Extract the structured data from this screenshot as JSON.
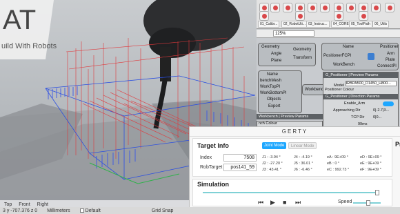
{
  "viewport": {
    "logo_letters": "AT",
    "logo_tagline": "uild With Robots",
    "view_tabs": [
      "Top",
      "Front",
      "Right"
    ],
    "units": "Millimeters",
    "default_label": "Default",
    "grid_snap": "Grid Snap",
    "coords": "3  y -707.376  z 0"
  },
  "grasshopper": {
    "ribbon_tabs": [
      "01_Calibr...",
      "02_RobotUti...",
      "03_Instruc...",
      "04_CORE",
      "05_ToolPath",
      "06_Utils"
    ],
    "zoom": "125%",
    "nodes": {
      "geom_in": [
        "Geometry",
        "Angle",
        "Plane"
      ],
      "geom_out": [
        "Geometry",
        "Transform"
      ],
      "positioner_in": [
        "Name",
        "PositionerFCPI",
        "WorkBench"
      ],
      "positioner_out": [
        "Positioner",
        "Arm",
        "Plate",
        "ConnectPl"
      ],
      "workbench_in": [
        "Name",
        "benchMesh",
        "WorkTopPl",
        "WorkBottomPl",
        "Objects",
        "Export"
      ],
      "workbench_label": "Workbench",
      "workbench_preview": "Workbench | Preview Params",
      "bench_colour": "nch Colour"
    },
    "pos_panel": {
      "header": "G_Positioner | Preview Params",
      "model_label": "Model",
      "model_value": "IRBPA500_D1450_H800...",
      "colour_label": "Positioner Colour",
      "dir_header": "G_Positioner | Direction Params",
      "enable_arm": "Enable_Arm",
      "approach_label": "Approaching Dir",
      "approach_value": "0|-2.7|3...",
      "tcp_label": "TCP Dir",
      "tcp_value": "0|0...",
      "footer": "99ms"
    }
  },
  "gerty": {
    "title": "GERTY",
    "target_info": {
      "heading": "Target Info",
      "joint_mode": "Joint Mode",
      "linear_mode": "Linear Mode",
      "index_label": "Index",
      "index_value": "7508",
      "robtarget_label": "RobTarget",
      "robtarget_value": "pos141_59",
      "joints": [
        [
          "J1 :",
          "-3.94 °"
        ],
        [
          "J2 :",
          "-27.20 °"
        ],
        [
          "J3 :",
          "43.41 °"
        ],
        [
          "J4 :",
          "-4.19 °"
        ],
        [
          "J5 :",
          "36.01 °"
        ],
        [
          "J6 :",
          "-6.46 °"
        ],
        [
          "eA :",
          "9E+09 °"
        ],
        [
          "eB :",
          "0 °"
        ],
        [
          "eC :",
          "992.73 °"
        ],
        [
          "eD :",
          "9E+09 °"
        ],
        [
          "eE :",
          "9E+09 °"
        ],
        [
          "eF :",
          "9E+09 °"
        ]
      ]
    },
    "simulation": {
      "heading": "Simulation",
      "progress": 0.99,
      "speed_label": "Speed",
      "speed": 0.55
    },
    "side_header": "Pr"
  },
  "colors": {
    "accent": "#1ea7ff",
    "slider": "#4fc3c9",
    "toolpath_red": "#e0383b",
    "toolpath_blue": "#2b4fe0"
  }
}
